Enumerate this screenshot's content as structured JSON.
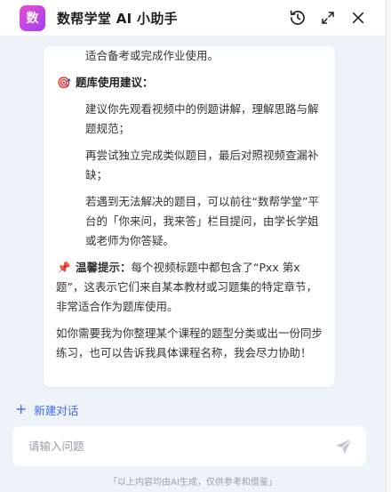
{
  "header": {
    "logo_text": "数",
    "title": "数帮学堂 AI 小助手",
    "icons": [
      "history-icon",
      "expand-icon",
      "close-icon"
    ]
  },
  "message": {
    "line_top": "适合备考或完成作业使用。",
    "section1": {
      "emoji": "🎯",
      "title": "题库使用建议：",
      "items": [
        "建议你先观看视频中的例题讲解，理解思路与解题规范；",
        "再尝试独立完成类似题目，最后对照视频查漏补缺；",
        "若遇到无法解决的题目，可以前往“数帮学堂”平台的「你来问，我来答」栏目提问，由学长学姐或老师为你答疑。"
      ]
    },
    "tip": {
      "emoji": "📌",
      "label": "温馨提示：",
      "text": "每个视频标题中都包含了“Pxx 第x题”，这表示它们来自某本教材或习题集的特定章节，非常适合作为题库使用。"
    },
    "closing": "如你需要我为你整理某个课程的题型分类或出一份同步练习，也可以告诉我具体课程名称，我会尽力协助！"
  },
  "new_chat": {
    "icon": "plus",
    "label": "新建对话"
  },
  "input": {
    "placeholder": "请输入问题",
    "value": "",
    "send_icon": "send-icon"
  },
  "footer": "「以上内容均由AI生成，仅供参考和借鉴」",
  "colors": {
    "accent": "#3d6bf0",
    "logo_gradient_start": "#e34fd1",
    "logo_gradient_end": "#a640f0",
    "background": "#eef2f9"
  }
}
